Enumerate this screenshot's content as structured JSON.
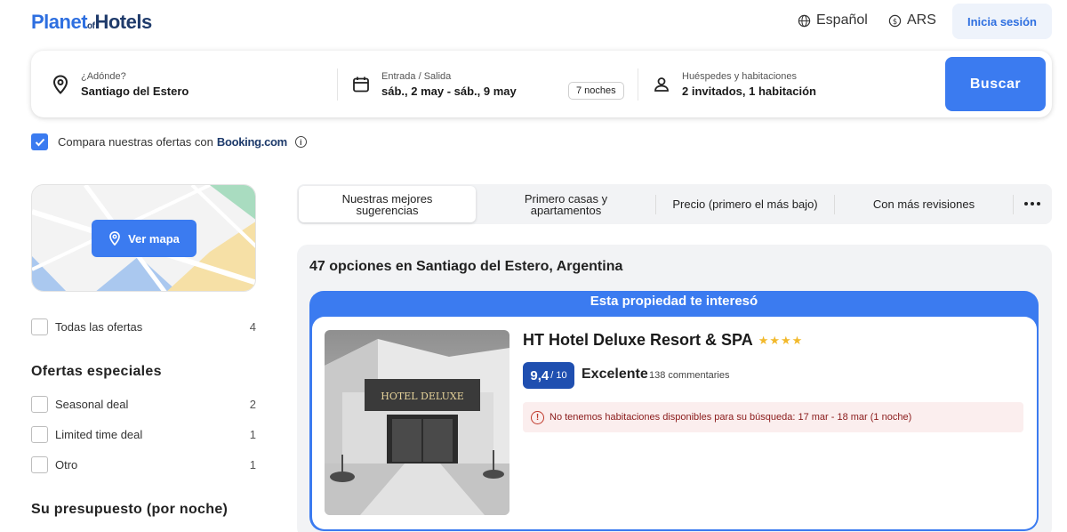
{
  "header": {
    "logo": {
      "part1": "Planet",
      "part2": "of",
      "part3": "Hotels"
    },
    "language": "Español",
    "currency": "ARS",
    "login": "Inicia sesión"
  },
  "search": {
    "destination_label": "¿Adónde?",
    "destination_value": "Santiago del Estero",
    "dates_label": "Entrada / Salida",
    "dates_value": "sáb., 2 may - sáb., 9 may",
    "nights": "7 noches",
    "guests_label": "Huéspedes y habitaciones",
    "guests_value": "2 invitados, 1 habitación",
    "button": "Buscar"
  },
  "compare": {
    "text": "Compara nuestras ofertas con",
    "brand": "Booking.com",
    "checked": true
  },
  "map": {
    "button": "Ver mapa"
  },
  "filters": {
    "all_offers": {
      "label": "Todas las ofertas",
      "count": "4"
    },
    "special_title": "Ofertas especiales",
    "special": [
      {
        "label": "Seasonal deal",
        "count": "2"
      },
      {
        "label": "Limited time deal",
        "count": "1"
      },
      {
        "label": "Otro",
        "count": "1"
      }
    ],
    "budget_title": "Su presupuesto (por noche)"
  },
  "sort": {
    "tabs": [
      {
        "label": "Nuestras mejores sugerencias"
      },
      {
        "label": "Primero casas y apartamentos"
      },
      {
        "label": "Precio (primero el más bajo)"
      },
      {
        "label": "Con más revisiones"
      }
    ]
  },
  "results": {
    "title": "47 opciones en Santiago del Estero, Argentina",
    "card": {
      "banner": "Esta propiedad te interesó",
      "hotel_name": "HT Hotel Deluxe Resort & SPA",
      "stars": "★★★★",
      "score": "9,4",
      "score_den": "/ 10",
      "rating_word": "Excelente",
      "reviews": "138 commentaries",
      "alert": "No tenemos habitaciones disponibles para su búsqueda: 17 mar - 18 mar (1 noche)",
      "image_sign": "HOTEL DELUXE"
    }
  },
  "colors": {
    "primary": "#3b7bf0",
    "score_bg": "#1f4fb0",
    "alert_bg": "#fbeeee",
    "star": "#f2b92c"
  }
}
